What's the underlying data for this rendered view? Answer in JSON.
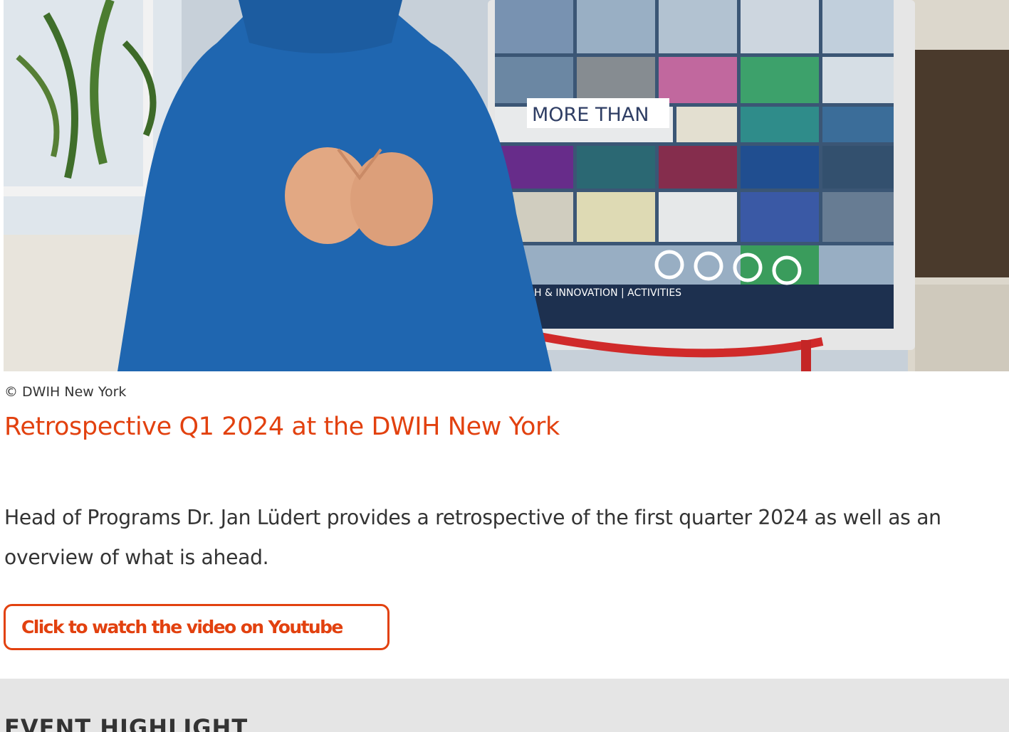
{
  "video": {
    "thumbnail_icon": "video-thumbnail-image",
    "screen_text": {
      "headline": "MORE THAN",
      "footer": "H & INNOVATION | ACTIVITIES"
    }
  },
  "article": {
    "copyright": "© DWIH New York",
    "title": "Retrospective Q1 2024 at the DWIH New York",
    "description": "Head of Programs Dr. Jan Lüdert provides a retrospective of the first quarter 2024 as well as an overview of what is ahead.",
    "cta_label": "Click to watch the video on Youtube"
  },
  "event_highlight": {
    "heading": "EVENT HIGHLIGHT"
  },
  "colors": {
    "accent": "#e2410f",
    "text": "#333333",
    "section_bg": "#e5e5e5",
    "sweater": "#1f66b0"
  }
}
